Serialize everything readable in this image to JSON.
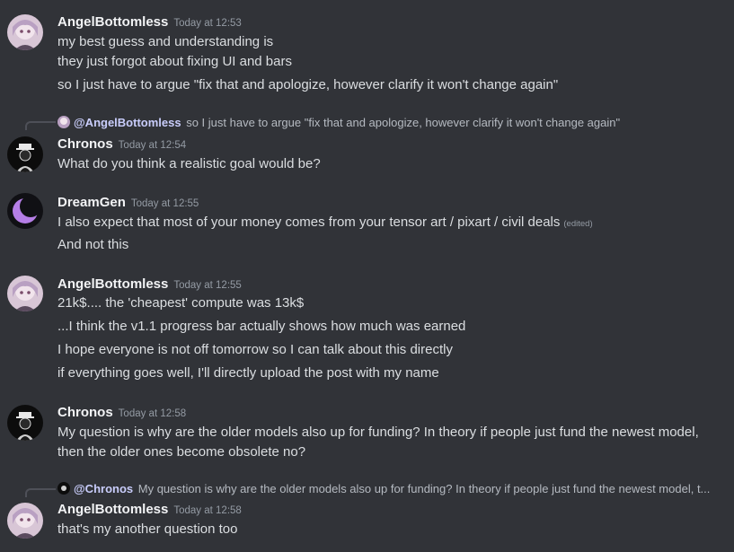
{
  "messages": [
    {
      "username": "AngelBottomless",
      "timestamp": "Today at 12:53",
      "lines": [
        "my best guess and understanding is",
        "they just forgot about fixing UI and bars",
        "so I just have to argue \"fix that and apologize, however clarify it won't change again\""
      ]
    },
    {
      "reply": {
        "name": "@AngelBottomless",
        "text": "so I just have to argue \"fix that and apologize, however clarify it won't change again\""
      },
      "username": "Chronos",
      "timestamp": "Today at 12:54",
      "lines": [
        "What do you think a realistic goal would be?"
      ]
    },
    {
      "username": "DreamGen",
      "timestamp": "Today at 12:55",
      "lines": [
        "I also expect that most of your money comes from your tensor art / pixart / civil deals",
        "And not this"
      ],
      "edited": "(edited)"
    },
    {
      "username": "AngelBottomless",
      "timestamp": "Today at 12:55",
      "lines": [
        "21k$.... the 'cheapest' compute was 13k$",
        "...I think the v1.1 progress bar actually shows how much was earned",
        "I hope everyone is not off tomorrow so I can talk about this directly",
        "if everything goes well, I'll directly upload the post with my name"
      ]
    },
    {
      "username": "Chronos",
      "timestamp": "Today at 12:58",
      "lines": [
        "My question is why are the older models also up for funding? In theory if people just fund the newest model, then the older ones become obsolete no?"
      ]
    },
    {
      "reply": {
        "name": "@Chronos",
        "text": "My question is why are the older models also up for funding? In theory if people just fund the newest model, t..."
      },
      "username": "AngelBottomless",
      "timestamp": "Today at 12:58",
      "lines": [
        "that's my another question too"
      ]
    }
  ],
  "colors": {
    "background": "#313338",
    "username": "#f2f3f5",
    "text": "#dbdee1",
    "muted": "#949ba4",
    "dreamgen_avatar": "#b57ee6"
  }
}
